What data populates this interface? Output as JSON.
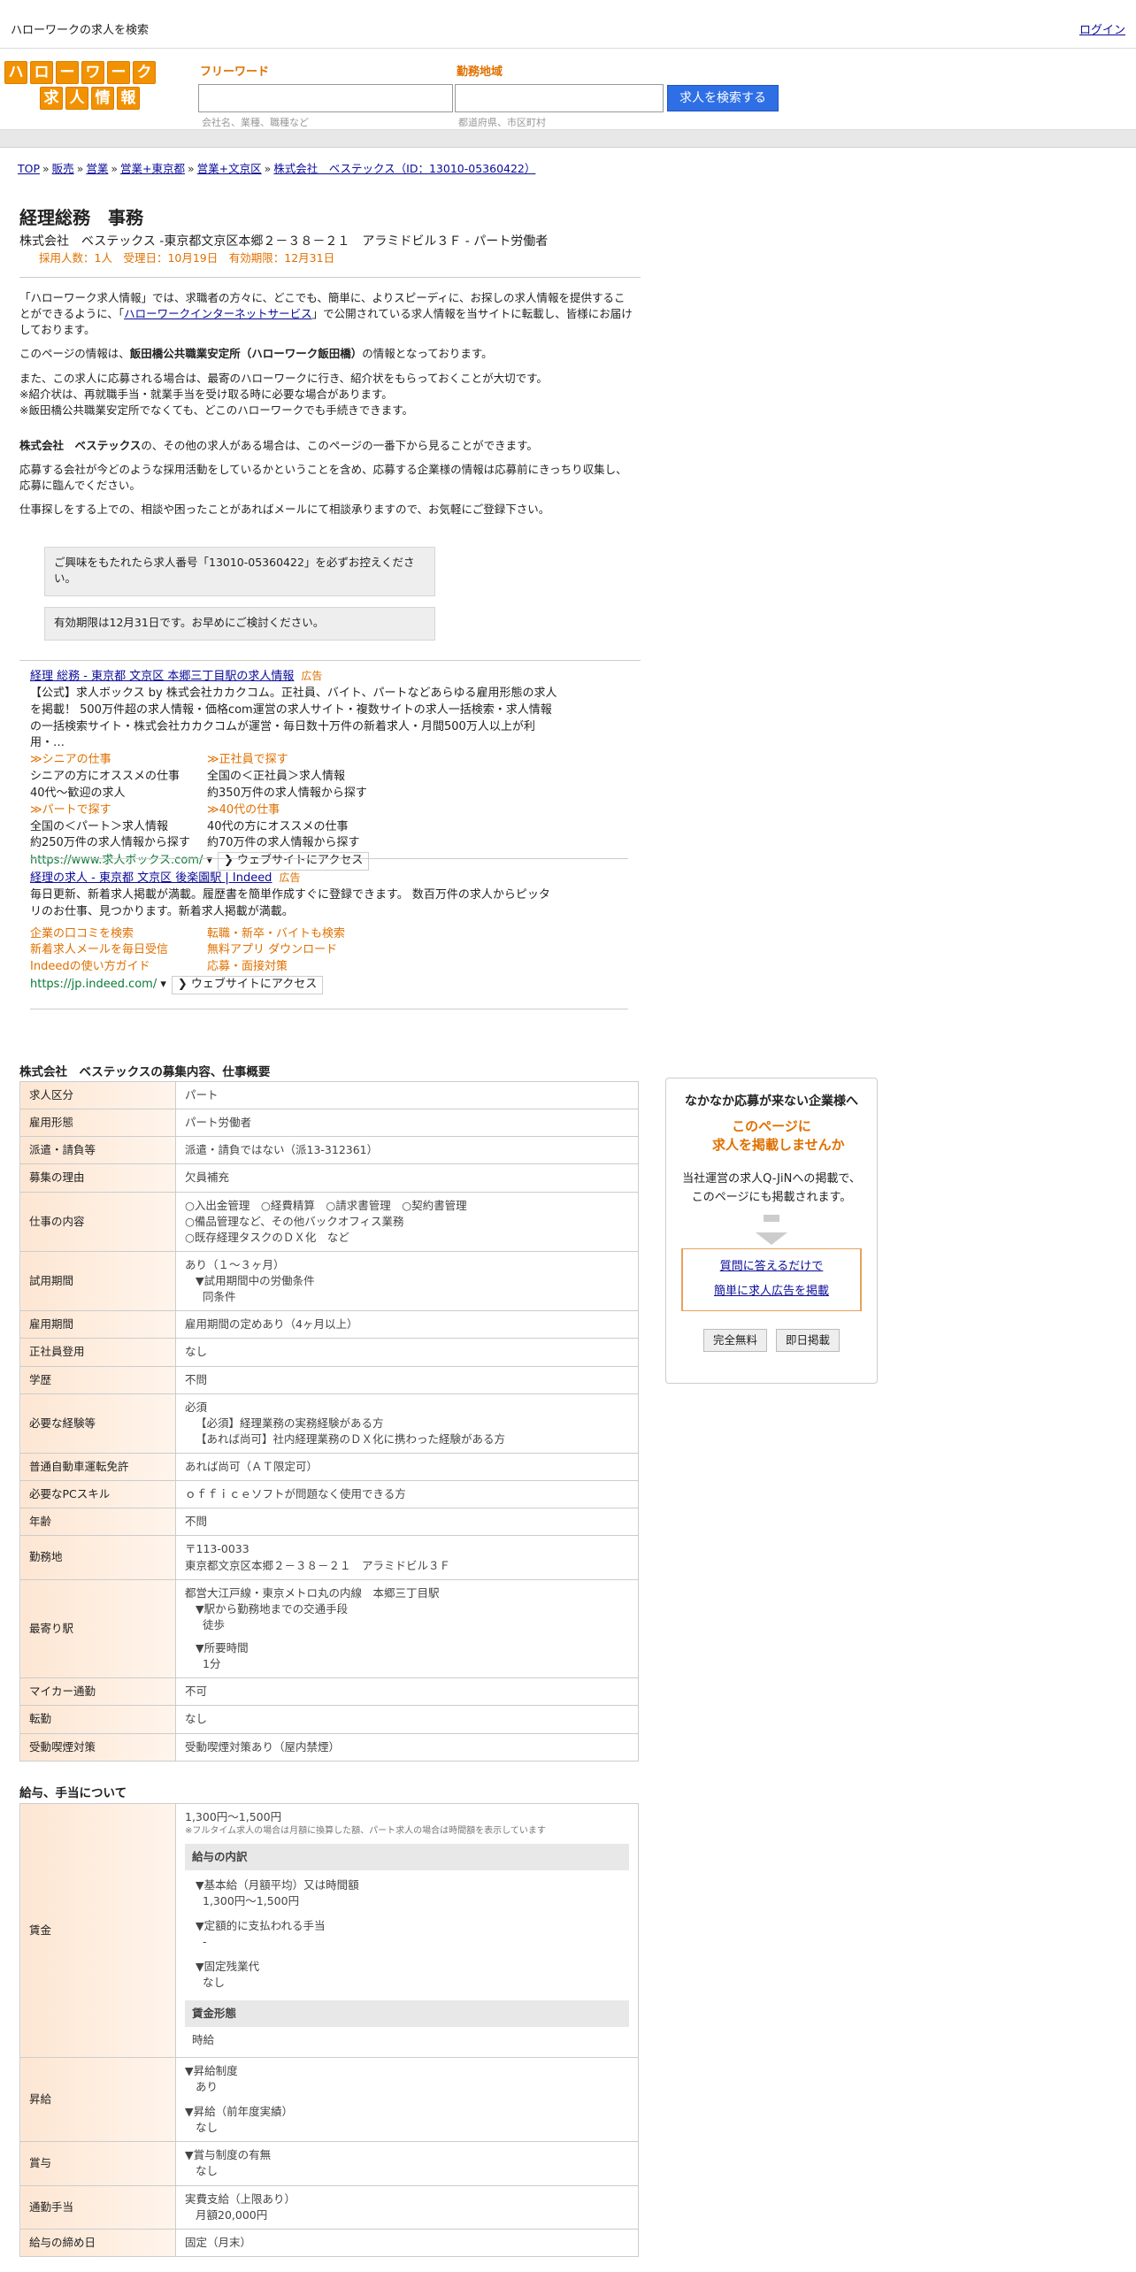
{
  "header": {
    "site_desc": "ハローワークの求人を検索",
    "login": "ログイン"
  },
  "logo": {
    "row1": [
      "ハ",
      "ロ",
      "ー",
      "ワ",
      "ー",
      "ク"
    ],
    "row2": [
      "求",
      "人",
      "情",
      "報"
    ]
  },
  "search": {
    "freeword_label": "フリーワード",
    "freeword_placeholder": "会社名、業種、職種など",
    "area_label": "勤務地域",
    "area_placeholder": "都道府県、市区町村",
    "button": "求人を検索する"
  },
  "breadcrumb": [
    "TOP",
    "販売",
    "営業",
    "営業+東京都",
    "営業+文京区",
    "株式会社　ベステックス（ID：13010-05360422）"
  ],
  "job": {
    "title": "経理総務　事務",
    "subtitle": "株式会社　ベステックス -東京都文京区本郷２－３８－２１　アラミドビル３Ｆ - パート労働者",
    "meta": "採用人数：1人　受理日：10月19日　有効期限：12月31日"
  },
  "intro": {
    "p1_a": "「ハローワーク求人情報」では、求職者の方々に、どこでも、簡単に、よりスピーディに、お探しの求人情報を提供することができるように、「",
    "p1_link": "ハローワークインターネットサービス",
    "p1_b": "」で公開されている求人情報を当サイトに転載し、皆様にお届けしております。",
    "p2_a": "このページの情報は、",
    "p2_bold": "飯田橋公共職業安定所（ハローワーク飯田橋）",
    "p2_b": "の情報となっております。",
    "p3_1": "また、この求人に応募される場合は、最寄のハローワークに行き、紹介状をもらっておくことが大切です。",
    "p3_2": "※紹介状は、再就職手当・就業手当を受け取る時に必要な場合があります。",
    "p3_3": "※飯田橋公共職業安定所でなくても、どこのハローワークでも手続きできます。",
    "p4_bold": "株式会社　ベステックス",
    "p4_b": "の、その他の求人がある場合は、このページの一番下から見ることができます。",
    "p5": "応募する会社が今どのような採用活動をしているかということを含め、応募する企業様の情報は応募前にきっちり収集し、応募に臨んでください。",
    "p6": "仕事探しをする上での、相談や困ったことがあればメールにて相談承りますので、お気軽にご登録下さい。"
  },
  "notices": {
    "n1": "ご興味をもたれたら求人番号「13010-05360422」を必ずお控えください。",
    "n2": "有効期限は12月31日です。お早めにご検討ください。"
  },
  "ads": [
    {
      "title": "経理 総務 - 東京都 文京区 本郷三丁目駅の求人情報",
      "tag": "広告",
      "desc": "【公式】求人ボックス by 株式会社カカクコム。正社員、バイト、パートなどあらゆる雇用形態の求人を掲載！ 500万件超の求人情報・価格com運営の求人サイト・複数サイトの求人一括検索・求人情報の一括検索サイト・株式会社カカクコムが運営・毎日数十万件の新着求人・月間500万人以上が利用・…",
      "links": [
        {
          "k": "≫シニアの仕事",
          "v1": "シニアの方にオススメの仕事",
          "v2": "40代～歓迎の求人"
        },
        {
          "k": "≫正社員で探す",
          "v1": "全国の＜正社員＞求人情報",
          "v2": "約350万件の求人情報から探す"
        },
        {
          "k": "≫パートで探す",
          "v1": "全国の＜パート＞求人情報",
          "v2": "約250万件の求人情報から探す"
        },
        {
          "k": "≫40代の仕事",
          "v1": "40代の方にオススメの仕事",
          "v2": "約70万件の求人情報から探す"
        }
      ],
      "url": "https://www.求人ボックス.com/",
      "visit": "❯ ウェブサイトにアクセス"
    },
    {
      "title": "経理の求人 - 東京都 文京区 後楽園駅 | Indeed",
      "tag": "広告",
      "desc": "毎日更新、新着求人掲載が満載。履歴書を簡単作成すぐに登録できます。 数百万件の求人からピッタリのお仕事、見つかります。新着求人掲載が満載。",
      "links": [
        {
          "k": "企業の口コミを検索",
          "v1": "",
          "v2": ""
        },
        {
          "k": "転職・新卒・バイトも検索",
          "v1": "",
          "v2": ""
        },
        {
          "k": "新着求人メールを毎日受信",
          "v1": "",
          "v2": ""
        },
        {
          "k": "無料アプリ ダウンロード",
          "v1": "",
          "v2": ""
        },
        {
          "k": "Indeedの使い方ガイド",
          "v1": "",
          "v2": ""
        },
        {
          "k": "応募・面接対策",
          "v1": "",
          "v2": ""
        }
      ],
      "url": "https://jp.indeed.com/",
      "visit": "❯ ウェブサイトにアクセス"
    }
  ],
  "summary_title": "株式会社　ベステックスの募集内容、仕事概要",
  "summary": [
    {
      "k": "求人区分",
      "v": [
        "パート"
      ]
    },
    {
      "k": "雇用形態",
      "v": [
        "パート労働者"
      ]
    },
    {
      "k": "派遣・請負等",
      "v": [
        "派遣・請負ではない（派13-312361）"
      ]
    },
    {
      "k": "募集の理由",
      "v": [
        "欠員補充"
      ]
    },
    {
      "k": "仕事の内容",
      "v": [
        "○入出金管理　○経費精算　○請求書管理　○契約書管理",
        "○備品管理など、その他バックオフィス業務",
        "○既存経理タスクのＤＸ化　など"
      ]
    },
    {
      "k": "試用期間",
      "v": [
        "あり（１～３ヶ月）",
        "▼試用期間中の労働条件",
        "同条件"
      ]
    },
    {
      "k": "雇用期間",
      "v": [
        "雇用期間の定めあり（4ヶ月以上）"
      ]
    },
    {
      "k": "正社員登用",
      "v": [
        "なし"
      ]
    },
    {
      "k": "学歴",
      "v": [
        "不問"
      ]
    },
    {
      "k": "必要な経験等",
      "v": [
        "必須",
        "【必須】経理業務の実務経験がある方",
        "【あれば尚可】社内経理業務のＤＸ化に携わった経験がある方"
      ]
    },
    {
      "k": "普通自動車運転免許",
      "v": [
        "あれば尚可（ＡＴ限定可）"
      ]
    },
    {
      "k": "必要なPCスキル",
      "v": [
        "ｏｆｆｉｃｅソフトが問題なく使用できる方"
      ]
    },
    {
      "k": "年齢",
      "v": [
        "不問"
      ]
    },
    {
      "k": "勤務地",
      "v": [
        "〒113-0033",
        "東京都文京区本郷２－３８－２１　アラミドビル３Ｆ"
      ]
    },
    {
      "k": "最寄り駅",
      "v": [
        "都営大江戸線・東京メトロ丸の内線　本郷三丁目駅",
        "▼駅から勤務地までの交通手段",
        "徒歩",
        "▼所要時間",
        "1分"
      ]
    },
    {
      "k": "マイカー通勤",
      "v": [
        "不可"
      ]
    },
    {
      "k": "転勤",
      "v": [
        "なし"
      ]
    },
    {
      "k": "受動喫煙対策",
      "v": [
        "受動喫煙対策あり（屋内禁煙）"
      ]
    }
  ],
  "pay_title": "給与、手当について",
  "pay": {
    "wage_k": "賃金",
    "wage_range": "1,300円〜1,500円",
    "wage_note": "※フルタイム求人の場合は月額に換算した額、パート求人の場合は時間額を表示しています",
    "breakdown_head": "給与の内訳",
    "base_label": "▼基本給（月額平均）又は時間額",
    "base_value": "1,300円〜1,500円",
    "fixed_label": "▼定額的に支払われる手当",
    "fixed_value": "-",
    "ot_label": "▼固定残業代",
    "ot_value": "なし",
    "form_head": "賃金形態",
    "form_value": "時給",
    "raise_k": "昇給",
    "raise1_label": "▼昇給制度",
    "raise1_value": "あり",
    "raise2_label": "▼昇給（前年度実績）",
    "raise2_value": "なし",
    "bonus_k": "賞与",
    "bonus_label": "▼賞与制度の有無",
    "bonus_value": "なし",
    "commute_k": "通勤手当",
    "commute_v1": "実費支給（上限あり）",
    "commute_v2": "月額20,000円",
    "close_k": "給与の締め日",
    "close_v": "固定（月末）"
  },
  "side": {
    "s1": "なかなか応募が来ない企業様へ",
    "s2a": "このページに",
    "s2b": "求人を掲載しませんか",
    "s3a": "当社運営の求人Q-JiNへの掲載で、",
    "s3b": "このページにも掲載されます。",
    "link1": "質問に答えるだけで",
    "link2": "簡単に求人広告を掲載",
    "btn1": "完全無料",
    "btn2": "即日掲載"
  }
}
